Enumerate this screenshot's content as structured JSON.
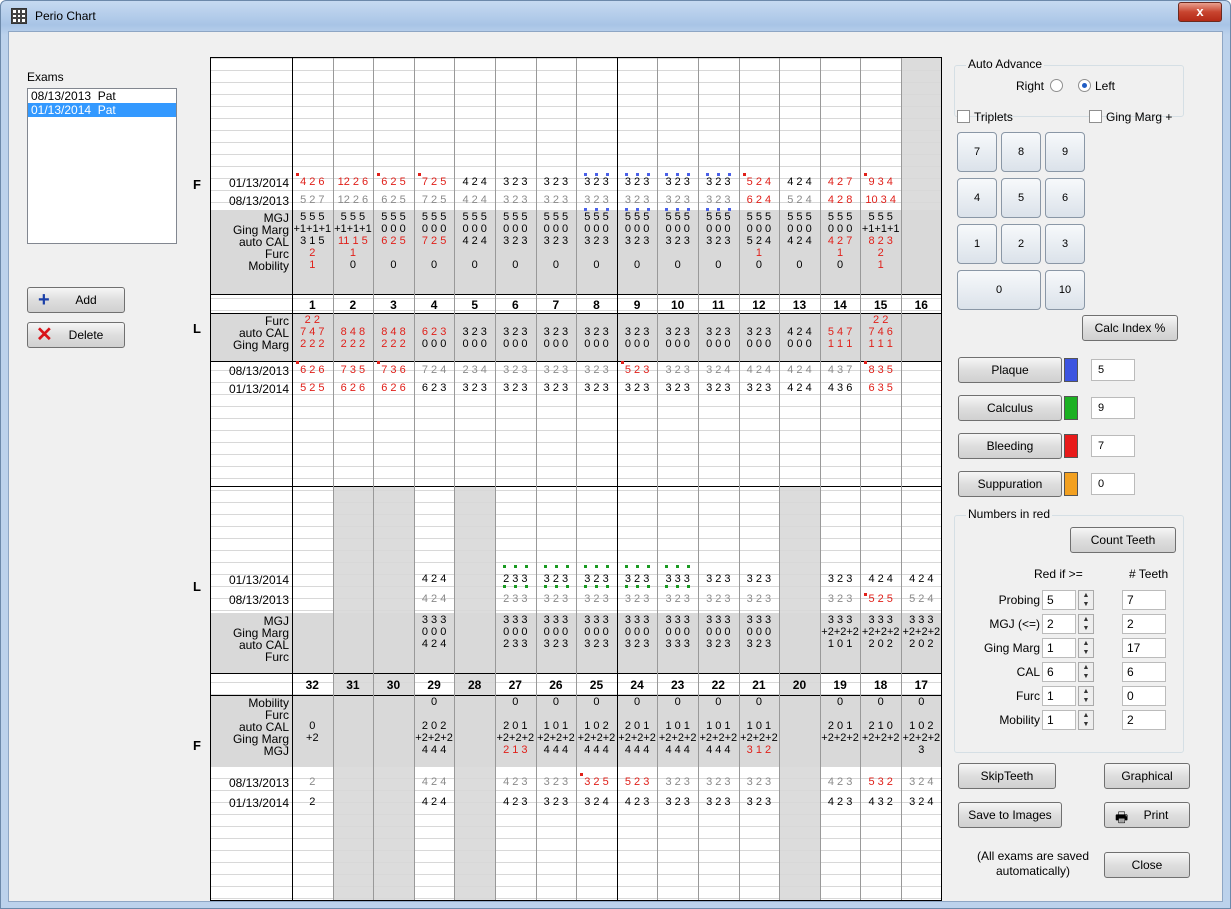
{
  "window": {
    "title": "Perio Chart",
    "close_glyph": "x"
  },
  "exams": {
    "label": "Exams",
    "items": [
      "08/13/2013  Pat",
      "01/13/2014  Pat"
    ],
    "selected_index": 1
  },
  "buttons": {
    "add": "Add",
    "delete": "Delete",
    "calc_index": "Calc Index %",
    "count_teeth": "Count Teeth",
    "skip_teeth": "SkipTeeth",
    "graphical": "Graphical",
    "save_images": "Save to Images",
    "print": "Print",
    "close": "Close"
  },
  "auto_advance": {
    "label": "Auto Advance",
    "right": "Right",
    "left": "Left",
    "selected": "Left"
  },
  "options": {
    "triplets": "Triplets",
    "ging_marg_plus": "Ging Marg +"
  },
  "keypad": [
    "7",
    "8",
    "9",
    "4",
    "5",
    "6",
    "1",
    "2",
    "3",
    "0",
    "10"
  ],
  "indices": [
    {
      "label": "Plaque",
      "value": "5",
      "color": "#3c54e0"
    },
    {
      "label": "Calculus",
      "value": "9",
      "color": "#1bb022"
    },
    {
      "label": "Bleeding",
      "value": "7",
      "color": "#e81a1a"
    },
    {
      "label": "Suppuration",
      "value": "0",
      "color": "#f2a020"
    }
  ],
  "red_numbers": {
    "label": "Numbers in red",
    "red_if_header": "Red if >=",
    "teeth_header": "# Teeth",
    "rows": [
      {
        "label": "Probing",
        "value": "5",
        "teeth": "7"
      },
      {
        "label": "MGJ (<=)",
        "value": "2",
        "teeth": "2"
      },
      {
        "label": "Ging Marg",
        "value": "1",
        "teeth": "17"
      },
      {
        "label": "CAL",
        "value": "6",
        "teeth": "6"
      },
      {
        "label": "Furc",
        "value": "1",
        "teeth": "0"
      },
      {
        "label": "Mobility",
        "value": "1",
        "teeth": "2"
      }
    ]
  },
  "autosave_note": "(All exams are saved automatically)",
  "upper": {
    "side_f": "F",
    "side_l": "L",
    "teeth": [
      "1",
      "2",
      "3",
      "4",
      "5",
      "6",
      "7",
      "8",
      "9",
      "10",
      "11",
      "12",
      "13",
      "14",
      "15",
      "16"
    ],
    "facial_rows": [
      {
        "label": "01/13/2014",
        "cells": [
          "4 2 6",
          "12 2 6",
          "6 2 5",
          "7 2 5",
          "4 2 4",
          "3 2 3",
          "3 2 3",
          "3 2 3",
          "3 2 3",
          "3 2 3",
          "3 2 3",
          "5 2 4",
          "4 2 4",
          "4 2 7",
          "9 3 4",
          ""
        ]
      },
      {
        "label": "08/13/2013",
        "cells": [
          "5 2 7",
          "12 2 6",
          "6 2 5",
          "7 2 5",
          "4 2 4",
          "3 2 3",
          "3 2 3",
          "3 2 3",
          "3 2 3",
          "3 2 3",
          "3 2 3",
          "6 2 4",
          "5 2 4",
          "4 2 8",
          "10 3 4",
          ""
        ]
      },
      {
        "label": "MGJ",
        "cells": [
          "5 5 5",
          "5 5 5",
          "5 5 5",
          "5 5 5",
          "5 5 5",
          "5 5 5",
          "5 5 5",
          "5 5 5",
          "5 5 5",
          "5 5 5",
          "5 5 5",
          "5 5 5",
          "5 5 5",
          "5 5 5",
          "5 5 5",
          ""
        ]
      },
      {
        "label": "Ging Marg",
        "cells": [
          "+1+1+1",
          "+1+1+1",
          "0 0 0",
          "0 0 0",
          "0 0 0",
          "0 0 0",
          "0 0 0",
          "0 0 0",
          "0 0 0",
          "0 0 0",
          "0 0 0",
          "0 0 0",
          "0 0 0",
          "0 0 0",
          "+1+1+1",
          ""
        ]
      },
      {
        "label": "auto CAL",
        "cells": [
          "3 1 5",
          "11 1 5",
          "6 2 5",
          "7 2 5",
          "4 2 4",
          "3 2 3",
          "3 2 3",
          "3 2 3",
          "3 2 3",
          "3 2 3",
          "3 2 3",
          "5 2 4",
          "4 2 4",
          "4 2 7",
          "8 2 3",
          ""
        ]
      },
      {
        "label": "Furc",
        "cells": [
          "2",
          "1",
          "",
          "",
          "",
          "",
          "",
          "",
          "",
          "",
          "",
          "1",
          "",
          "1",
          "2",
          ""
        ]
      },
      {
        "label": "Mobility",
        "cells": [
          "1",
          "0",
          "0",
          "0",
          "0",
          "0",
          "0",
          "0",
          "0",
          "0",
          "0",
          "0",
          "0",
          "0",
          "1",
          ""
        ]
      }
    ],
    "lingual_rows": [
      {
        "label": "Furc",
        "cells": [
          "2  2",
          "",
          "",
          "",
          "",
          "",
          "",
          "",
          "",
          "",
          "",
          "",
          "",
          "",
          "2  2",
          ""
        ]
      },
      {
        "label": "auto CAL",
        "cells": [
          "7 4 7",
          "8 4 8",
          "8 4 8",
          "6 2 3",
          "3 2 3",
          "3 2 3",
          "3 2 3",
          "3 2 3",
          "3 2 3",
          "3 2 3",
          "3 2 3",
          "3 2 3",
          "4 2 4",
          "5 4 7",
          "7 4 6",
          ""
        ]
      },
      {
        "label": "Ging Marg",
        "cells": [
          "2 2 2",
          "2 2 2",
          "2 2 2",
          "0 0 0",
          "0 0 0",
          "0 0 0",
          "0 0 0",
          "0 0 0",
          "0 0 0",
          "0 0 0",
          "0 0 0",
          "0 0 0",
          "0 0 0",
          "1 1 1",
          "1 1 1",
          ""
        ]
      },
      {
        "label": "08/13/2013",
        "cells": [
          "6 2 6",
          "7 3 5",
          "7 3 6",
          "7 2 4",
          "2 3 4",
          "3 2 3",
          "3 2 3",
          "3 2 3",
          "5 2 3",
          "3 2 3",
          "3 2 4",
          "4 2 4",
          "4 2 4",
          "4 3 7",
          "8 3 5",
          ""
        ]
      },
      {
        "label": "01/13/2014",
        "cells": [
          "5 2 5",
          "6 2 6",
          "6 2 6",
          "6 2 3",
          "3 2 3",
          "3 2 3",
          "3 2 3",
          "3 2 3",
          "3 2 3",
          "3 2 3",
          "3 2 3",
          "3 2 3",
          "4 2 4",
          "4 3 6",
          "6 3 5",
          ""
        ]
      }
    ]
  },
  "lower": {
    "side_l": "L",
    "side_f": "F",
    "teeth": [
      "32",
      "31",
      "30",
      "29",
      "28",
      "27",
      "26",
      "25",
      "24",
      "23",
      "22",
      "21",
      "20",
      "19",
      "18",
      "17"
    ],
    "lingual_rows": [
      {
        "label": "01/13/2014",
        "cells": [
          "",
          "",
          "",
          "4 2 4",
          "",
          "2 3 3",
          "3 2 3",
          "3 2 3",
          "3 2 3",
          "3 3 3",
          "3 2 3",
          "3 2 3",
          "",
          "3 2 3",
          "4 2 4",
          "4 2 4"
        ]
      },
      {
        "label": "08/13/2013",
        "cells": [
          "",
          "",
          "",
          "4 2 4",
          "",
          "2 3 3",
          "3 2 3",
          "3 2 3",
          "3 2 3",
          "3 2 3",
          "3 2 3",
          "3 2 3",
          "",
          "3 2 3",
          "5 2 5",
          "5 2 4"
        ]
      },
      {
        "label": "MGJ",
        "cells": [
          "",
          "",
          "",
          "3 3 3",
          "",
          "3 3 3",
          "3 3 3",
          "3 3 3",
          "3 3 3",
          "3 3 3",
          "3 3 3",
          "3 3 3",
          "",
          "3 3 3",
          "3 3 3",
          "3 3 3"
        ]
      },
      {
        "label": "Ging Marg",
        "cells": [
          "",
          "",
          "",
          "0 0 0",
          "",
          "0 0 0",
          "0 0 0",
          "0 0 0",
          "0 0 0",
          "0 0 0",
          "0 0 0",
          "0 0 0",
          "",
          "+2+2+2",
          "+2+2+2",
          "+2+2+2"
        ]
      },
      {
        "label": "auto CAL",
        "cells": [
          "",
          "",
          "",
          "4 2 4",
          "",
          "2 3 3",
          "3 2 3",
          "3 2 3",
          "3 2 3",
          "3 3 3",
          "3 2 3",
          "3 2 3",
          "",
          "1 0 1",
          "2 0 2",
          "2 0 2"
        ]
      },
      {
        "label": "Furc",
        "cells": [
          "",
          "",
          "",
          "",
          "",
          "",
          "",
          "",
          "",
          "",
          "",
          "",
          "",
          "",
          "",
          ""
        ]
      }
    ],
    "facial_rows": [
      {
        "label": "Mobility",
        "cells": [
          "",
          "",
          "",
          "0",
          "",
          "0",
          "0",
          "0",
          "0",
          "0",
          "0",
          "0",
          "",
          "0",
          "0",
          "0"
        ]
      },
      {
        "label": "Furc",
        "cells": [
          "",
          "",
          "",
          "",
          "",
          "",
          "",
          "",
          "",
          "",
          "",
          "",
          "",
          "",
          "",
          ""
        ]
      },
      {
        "label": "auto CAL",
        "cells": [
          "0",
          "",
          "",
          "2 0 2",
          "",
          "2 0 1",
          "1 0 1",
          "1 0 2",
          "2 0 1",
          "1 0 1",
          "1 0 1",
          "1 0 1",
          "",
          "2 0 1",
          "2 1 0",
          "1 0 2"
        ]
      },
      {
        "label": "Ging Marg",
        "cells": [
          "+2",
          "",
          "",
          "+2+2+2",
          "",
          "+2+2+2",
          "+2+2+2",
          "+2+2+2",
          "+2+2+2",
          "+2+2+2",
          "+2+2+2",
          "+2+2+2",
          "",
          "+2+2+2",
          "+2+2+2",
          "+2+2+2"
        ]
      },
      {
        "label": "MGJ",
        "cells": [
          "",
          "",
          "",
          "4 4 4",
          "",
          "2 1 3",
          "4 4 4",
          "4 4 4",
          "4 4 4",
          "4 4 4",
          "4 4 4",
          "3 1 2",
          "",
          "",
          "",
          "3"
        ]
      },
      {
        "label": "08/13/2013",
        "cells": [
          "2",
          "",
          "",
          "4 2 4",
          "",
          "4 2 3",
          "3 2 3",
          "3 2 5",
          "5 2 3",
          "3 2 3",
          "3 2 3",
          "3 2 3",
          "",
          "4 2 3",
          "5 3 2",
          "3 2 4"
        ]
      },
      {
        "label": "01/13/2014",
        "cells": [
          "2",
          "",
          "",
          "4 2 4",
          "",
          "4 2 3",
          "3 2 3",
          "3 2 4",
          "4 2 3",
          "3 2 3",
          "3 2 3",
          "3 2 3",
          "",
          "4 2 3",
          "4 3 2",
          "3 2 4"
        ]
      }
    ]
  }
}
